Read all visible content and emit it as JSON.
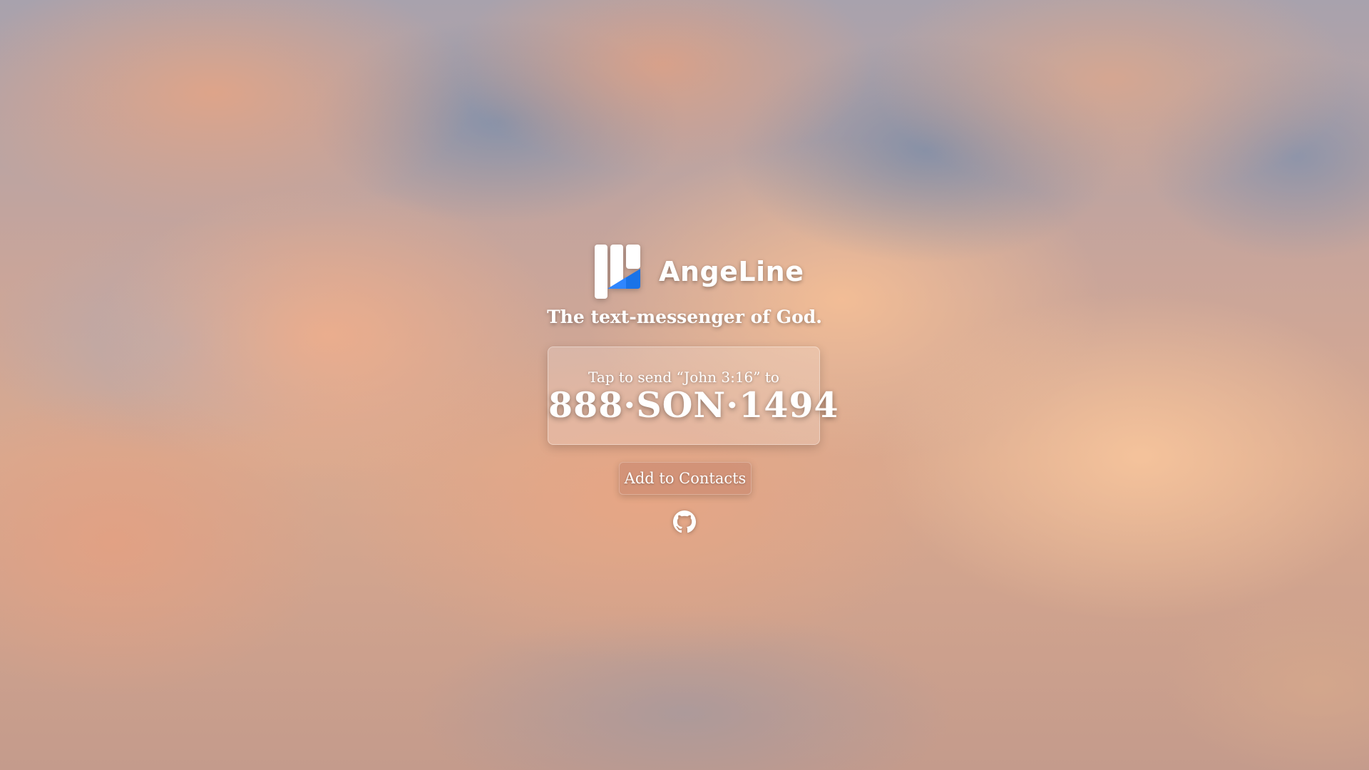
{
  "brand": {
    "name": "AngeLine",
    "logo_icon": "angeline-logo-icon",
    "logo_colors": {
      "bars": "#ffffff",
      "accent": "#1a73e8"
    }
  },
  "tagline": "The text-messenger of God.",
  "message_card": {
    "prompt": "Tap to send “John 3:16” to",
    "phone_number": "888·SON·1494"
  },
  "contacts_button": {
    "label": "Add to Contacts"
  },
  "footer": {
    "github_icon": "github-icon"
  },
  "colors": {
    "text": "#ffffff",
    "card_background": "rgba(255,255,255,0.18)",
    "button_background": "rgba(196,132,108,0.55)"
  }
}
